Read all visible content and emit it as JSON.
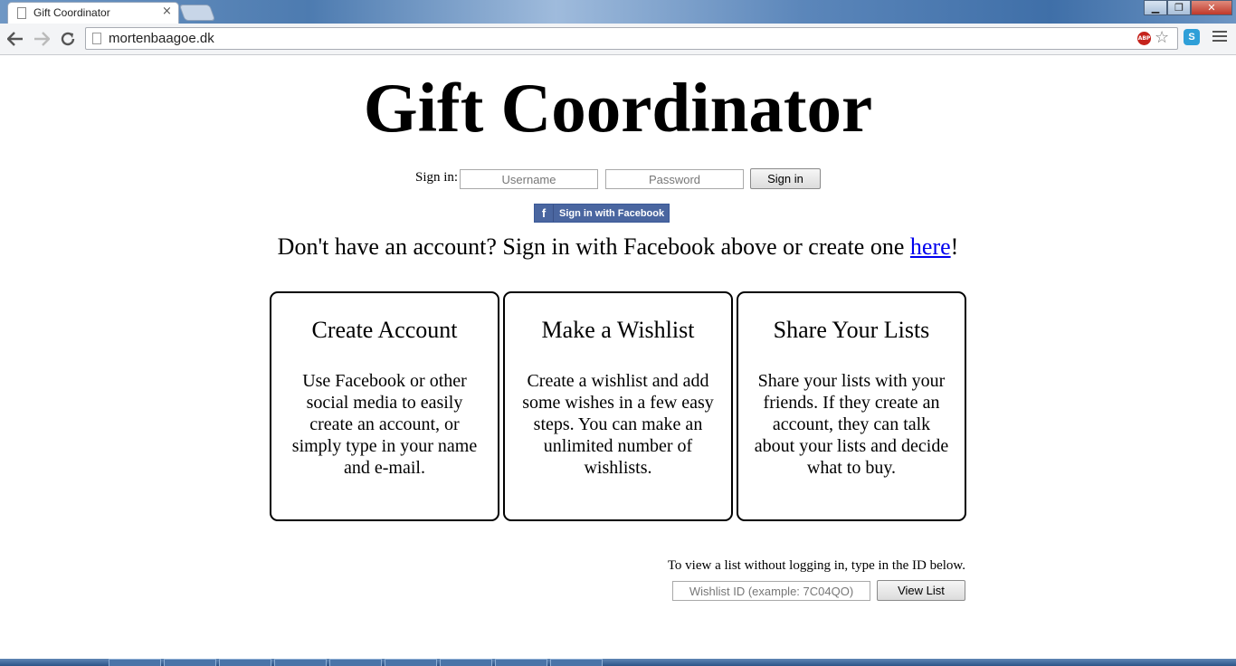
{
  "browser": {
    "tab_title": "Gift Coordinator",
    "tab_close": "×",
    "url": "mortenbaagoe.dk",
    "abp_label": "ABP",
    "star_icon": "☆",
    "ext_label": "S",
    "window_controls": {
      "minimize": "▁",
      "maximize": "❐",
      "close": "✕"
    }
  },
  "page": {
    "title": "Gift Coordinator",
    "signin": {
      "label": "Sign in:",
      "username_placeholder": "Username",
      "password_placeholder": "Password",
      "button": "Sign in"
    },
    "facebook": {
      "icon": "f",
      "label": "Sign in with Facebook"
    },
    "no_account": {
      "prefix": "Don't have an account? Sign in with Facebook above or create one ",
      "link": "here",
      "suffix": "!"
    },
    "cards": [
      {
        "title": "Create Account",
        "text": "Use Facebook or other social media to easily create an account, or simply type in your name and e-mail."
      },
      {
        "title": "Make a Wishlist",
        "text": "Create a wishlist and add some wishes in a few easy steps. You can make an unlimited number of wishlists."
      },
      {
        "title": "Share Your Lists",
        "text": "Share your lists with your friends. If they create an account, they can talk about your lists and decide what to buy."
      }
    ],
    "view_list": {
      "note": "To view a list without logging in, type in the ID below.",
      "placeholder": "Wishlist ID (example: 7C04QO)",
      "button": "View List"
    }
  },
  "colors": {
    "facebook_blue": "#4a66a0",
    "link_blue": "#0000ee"
  }
}
